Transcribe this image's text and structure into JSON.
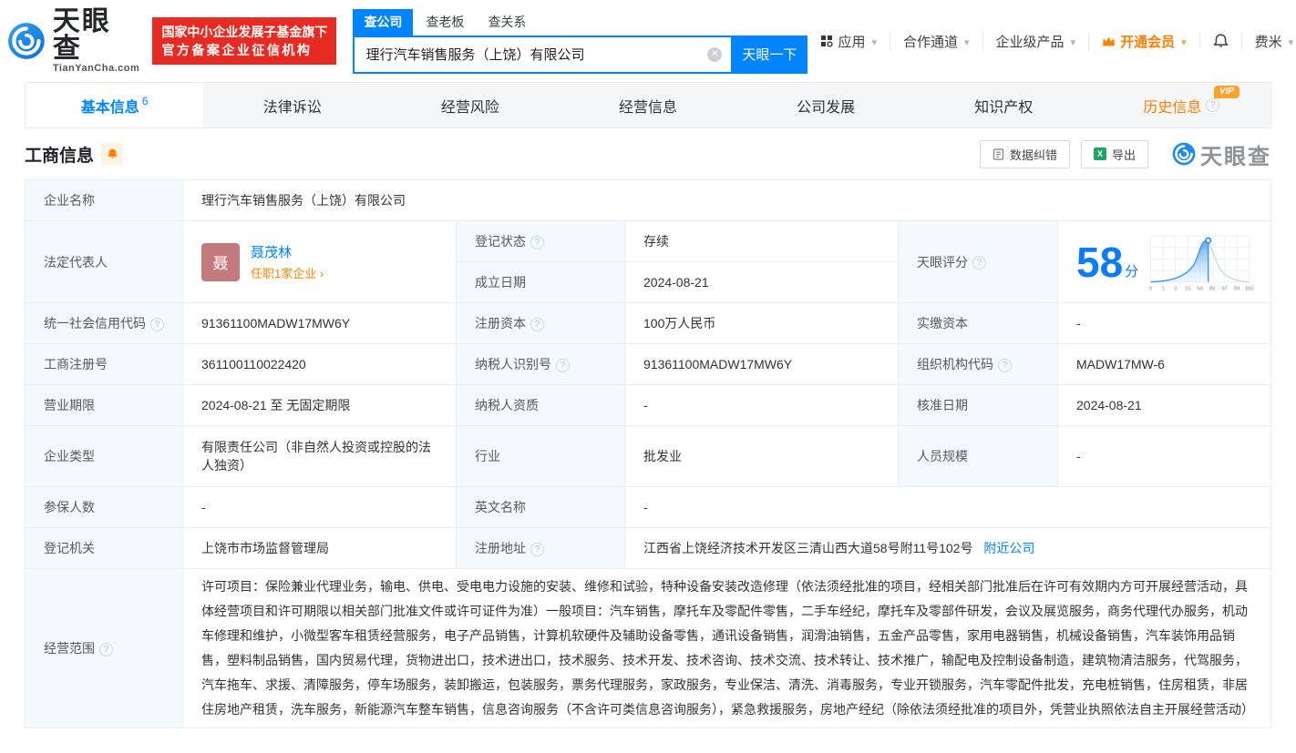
{
  "header": {
    "brand": "天眼查",
    "brand_domain": "TianYanCha.com",
    "badge_line1": "国家中小企业发展子基金旗下",
    "badge_line2": "官方备案企业征信机构",
    "search_tabs": [
      "查公司",
      "查老板",
      "查关系"
    ],
    "search_value": "理行汽车销售服务（上饶）有限公司",
    "search_button": "天眼一下",
    "nav": [
      "应用",
      "合作通道",
      "企业级产品",
      "开通会员",
      "费米"
    ]
  },
  "tabs": [
    {
      "label": "基本信息",
      "count": "6"
    },
    {
      "label": "法律诉讼"
    },
    {
      "label": "经营风险"
    },
    {
      "label": "经营信息"
    },
    {
      "label": "公司发展"
    },
    {
      "label": "知识产权"
    },
    {
      "label": "历史信息",
      "vip": "VIP"
    }
  ],
  "toolbar": {
    "title": "工商信息",
    "correction": "数据纠错",
    "export": "导出",
    "watermark": "天眼查"
  },
  "info": {
    "company_name": {
      "label": "企业名称",
      "value": "理行汽车销售服务（上饶）有限公司"
    },
    "legal_rep": {
      "label": "法定代表人",
      "avatar": "聂",
      "name": "聂茂林",
      "link": "任职1家企业 ›"
    },
    "reg_status": {
      "label": "登记状态",
      "value": "存续"
    },
    "establish_date": {
      "label": "成立日期",
      "value": "2024-08-21"
    },
    "score": {
      "label": "天眼评分",
      "value": "58",
      "unit": "分"
    },
    "credit_code": {
      "label": "统一社会信用代码",
      "value": "91361100MADW17MW6Y"
    },
    "reg_capital": {
      "label": "注册资本",
      "value": "100万人民币"
    },
    "paid_capital": {
      "label": "实缴资本",
      "value": "-"
    },
    "reg_number": {
      "label": "工商注册号",
      "value": "361100110022420"
    },
    "taxpayer_id": {
      "label": "纳税人识别号",
      "value": "91361100MADW17MW6Y"
    },
    "org_code": {
      "label": "组织机构代码",
      "value": "MADW17MW-6"
    },
    "business_term": {
      "label": "营业期限",
      "value": "2024-08-21 至 无固定期限"
    },
    "taxpayer_quality": {
      "label": "纳税人资质",
      "value": "-"
    },
    "approve_date": {
      "label": "核准日期",
      "value": "2024-08-21"
    },
    "company_type": {
      "label": "企业类型",
      "value": "有限责任公司（非自然人投资或控股的法人独资）"
    },
    "industry": {
      "label": "行业",
      "value": "批发业"
    },
    "staff_size": {
      "label": "人员规模",
      "value": "-"
    },
    "insured_count": {
      "label": "参保人数",
      "value": "-"
    },
    "english_name": {
      "label": "英文名称",
      "value": "-"
    },
    "reg_authority": {
      "label": "登记机关",
      "value": "上饶市市场监督管理局"
    },
    "reg_address": {
      "label": "注册地址",
      "value": "江西省上饶经济技术开发区三清山西大道58号附11号102号",
      "link": "附近公司"
    },
    "business_scope": {
      "label": "经营范围",
      "value": "许可项目：保险兼业代理业务，输电、供电、受电电力设施的安装、维修和试验，特种设备安装改造修理（依法须经批准的项目，经相关部门批准后在许可有效期内方可开展经营活动，具体经营项目和许可期限以相关部门批准文件或许可证件为准）一般项目：汽车销售，摩托车及零配件零售，二手车经纪，摩托车及零部件研发，会议及展览服务，商务代理代办服务，机动车修理和维护，小微型客车租赁经营服务，电子产品销售，计算机软硬件及辅助设备零售，通讯设备销售，润滑油销售，五金产品零售，家用电器销售，机械设备销售，汽车装饰用品销售，塑料制品销售，国内贸易代理，货物进出口，技术进出口，技术服务、技术开发、技术咨询、技术交流、技术转让、技术推广，输配电及控制设备制造，建筑物清洁服务，代驾服务，汽车拖车、求援、清障服务，停车场服务，装卸搬运，包装服务，票务代理服务，家政服务，专业保洁、清洗、消毒服务，专业开锁服务，汽车零配件批发，充电桩销售，住房租赁，非居住房地产租赁，洗车服务，新能源汽车整车销售，信息咨询服务（不含许可类信息咨询服务），紧急救援服务，房地产经纪（除依法须经批准的项目外，凭营业执照依法自主开展经营活动）"
    }
  },
  "chart_data": {
    "type": "area",
    "title": "天眼评分分布曲线",
    "score": 58,
    "x_ticks": [
      "0",
      "1",
      "3",
      "15",
      "50",
      "85",
      "97",
      "99",
      "100"
    ],
    "legend_position": "none",
    "grid": true,
    "accent_color": "#3d96f7"
  },
  "colors": {
    "primary_blue": "#0084ff",
    "vip_orange": "#ff7d00",
    "badge_red": "#e72a22",
    "status_green": "#2eb157",
    "label_bg": "#f4f9fd"
  }
}
